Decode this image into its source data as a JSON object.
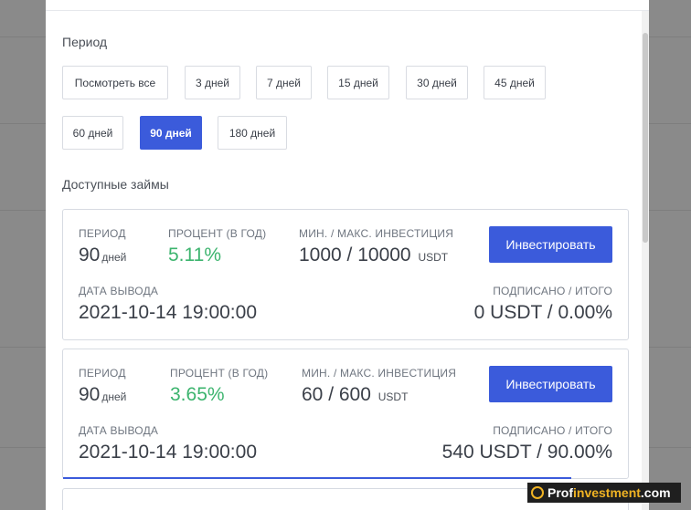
{
  "filters": {
    "period_label": "Период",
    "periods": [
      {
        "label": "Посмотреть все",
        "active": false
      },
      {
        "label": "3 дней",
        "active": false
      },
      {
        "label": "7 дней",
        "active": false
      },
      {
        "label": "15 дней",
        "active": false
      },
      {
        "label": "30 дней",
        "active": false
      },
      {
        "label": "45 дней",
        "active": false
      },
      {
        "label": "60 дней",
        "active": false
      },
      {
        "label": "90 дней",
        "active": true
      },
      {
        "label": "180 дней",
        "active": false
      }
    ]
  },
  "loans": {
    "title": "Доступные займы",
    "items": [
      {
        "period_cap": "ПЕРИОД",
        "period_value": "90",
        "period_unit": "дней",
        "rate_cap": "ПРОЦЕНТ (В ГОД)",
        "rate_value": "5.11%",
        "invest_cap": "МИН. / МАКС. ИНВЕСТИЦИЯ",
        "invest_value": "1000 / 10000",
        "invest_unit": "USDT",
        "button_label": "Инвестировать",
        "payout_cap": "ДАТА ВЫВОДА",
        "payout_value": "2021-10-14 19:00:00",
        "subscribed_cap": "ПОДПИСАНО / ИТОГО",
        "subscribed_value": "0 USDT / 0.00%",
        "progress": 0.0
      },
      {
        "period_cap": "ПЕРИОД",
        "period_value": "90",
        "period_unit": "дней",
        "rate_cap": "ПРОЦЕНТ (В ГОД)",
        "rate_value": "3.65%",
        "invest_cap": "МИН. / МАКС. ИНВЕСТИЦИЯ",
        "invest_value": "60 / 600",
        "invest_unit": "USDT",
        "button_label": "Инвестировать",
        "payout_cap": "ДАТА ВЫВОДА",
        "payout_value": "2021-10-14 19:00:00",
        "subscribed_cap": "ПОДПИСАНО / ИТОГО",
        "subscribed_value": "540 USDT / 90.00%",
        "progress": 0.9
      }
    ]
  },
  "watermark": {
    "part1": "Prof",
    "part2": "investment",
    "part3": ".com"
  },
  "colors": {
    "accent": "#3b5bdb",
    "positive": "#3cb46e"
  }
}
